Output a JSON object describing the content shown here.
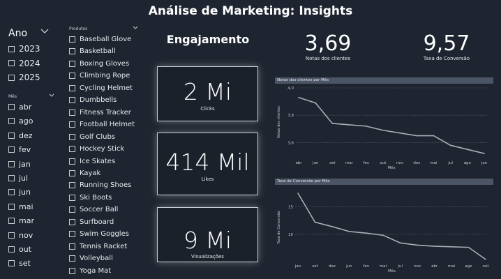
{
  "title": "Análise de Marketing: Insights",
  "ano_slicer": {
    "label": "Ano",
    "items": [
      "2023",
      "2024",
      "2025"
    ]
  },
  "mes_slicer": {
    "label": "Mês",
    "items": [
      "abr",
      "ago",
      "dez",
      "fev",
      "jan",
      "jul",
      "jun",
      "mai",
      "mar",
      "nov",
      "out",
      "set"
    ]
  },
  "produtos_slicer": {
    "label": "Produtos",
    "items": [
      "Baseball Glove",
      "Basketball",
      "Boxing Gloves",
      "Climbing Rope",
      "Cycling Helmet",
      "Dumbbells",
      "Fitness Tracker",
      "Football Helmet",
      "Golf Clubs",
      "Hockey Stick",
      "Ice Skates",
      "Kayak",
      "Running Shoes",
      "Ski Boots",
      "Soccer Ball",
      "Surfboard",
      "Swim Goggles",
      "Tennis Racket",
      "Volleyball",
      "Yoga Mat"
    ]
  },
  "engajamento": {
    "heading": "Engajamento",
    "cards": [
      {
        "value": "2 Mi",
        "label": "Clicks"
      },
      {
        "value": "414 Mil",
        "label": "Likes"
      },
      {
        "value": "9 Mi",
        "label": "Visualizações"
      }
    ]
  },
  "kpis": [
    {
      "value": "3,69",
      "label": "Notas dos clientes"
    },
    {
      "value": "9,57",
      "label": "Taxa de Conversão"
    }
  ],
  "colors": {
    "background": "#1e2530",
    "line": "#a9adb6",
    "header_bar": "#4b5566"
  },
  "chart_data": [
    {
      "type": "line",
      "title": "Notas dos clientes por Mês",
      "xlabel": "Mês",
      "ylabel": "Notas dos clientes",
      "categories": [
        "abr",
        "jun",
        "set",
        "mar",
        "fev",
        "out",
        "nov",
        "dez",
        "mai",
        "jul",
        "ago",
        "jan"
      ],
      "values": [
        3.93,
        3.89,
        3.74,
        3.73,
        3.72,
        3.69,
        3.67,
        3.65,
        3.65,
        3.58,
        3.55,
        3.52
      ],
      "ylim": [
        3.5,
        4.0
      ],
      "yticks": [
        "4,0",
        "3,8",
        "3,6"
      ],
      "ytick_values": [
        4.0,
        3.8,
        3.6
      ],
      "grid": true
    },
    {
      "type": "line",
      "title": "Taxa de Conversão por Mês",
      "xlabel": "Mês",
      "ylabel": "Taxa de Conversão",
      "categories": [
        "jan",
        "set",
        "dez",
        "jun",
        "fev",
        "mar",
        "jul",
        "nov",
        "abr",
        "mai",
        "ago",
        "out"
      ],
      "values": [
        17.5,
        12.2,
        11.4,
        10.5,
        10.2,
        9.8,
        8.4,
        8.0,
        7.8,
        7.7,
        7.6,
        5.4
      ],
      "ylim": [
        5.0,
        17.5
      ],
      "yticks": [
        "15",
        "10"
      ],
      "ytick_values": [
        15,
        10
      ],
      "grid": true
    }
  ]
}
